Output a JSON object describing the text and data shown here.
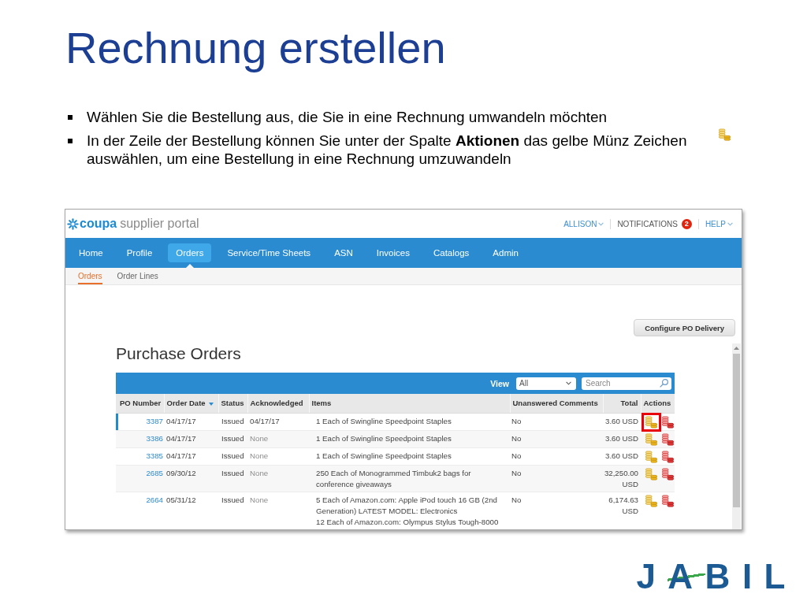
{
  "title": "Rechnung erstellen",
  "bullets": [
    {
      "text": "Wählen Sie die Bestellung aus, die Sie in eine Rechnung umwandeln möchten",
      "coin_icon": false
    },
    {
      "text": "In der Zeile der Bestellung können Sie unter der Spalte **Aktionen** das gelbe Münz Zeichen auswählen, um eine Bestellung in eine Rechnung umzuwandeln",
      "coin_icon": true
    }
  ],
  "portal": {
    "logo": {
      "brand": "coupa",
      "tagline": "supplier portal"
    },
    "top_links": [
      {
        "kind": "menu",
        "label": "ALLISON"
      },
      {
        "kind": "counter",
        "label": "NOTIFICATIONS",
        "badge": "2"
      },
      {
        "kind": "menu",
        "label": "HELP"
      }
    ],
    "nav": [
      {
        "label": "Home",
        "selected": false
      },
      {
        "label": "Profile",
        "selected": false
      },
      {
        "label": "Orders",
        "selected": true
      },
      {
        "label": "Service/Time Sheets",
        "selected": false
      },
      {
        "label": "ASN",
        "selected": false
      },
      {
        "label": "Invoices",
        "selected": false
      },
      {
        "label": "Catalogs",
        "selected": false
      },
      {
        "label": "Admin",
        "selected": false
      }
    ],
    "subnav": [
      {
        "label": "Orders",
        "selected": true
      },
      {
        "label": "Order Lines",
        "selected": false
      }
    ],
    "configure_button": "Configure PO Delivery",
    "heading": "Purchase Orders",
    "toolbar": {
      "view_label": "View",
      "view_value": "All",
      "search": {
        "placeholder": "Search"
      }
    },
    "table": {
      "columns": [
        {
          "label": "PO Number",
          "sorted": false
        },
        {
          "label": "Order Date",
          "sorted": true
        },
        {
          "label": "Status",
          "sorted": false
        },
        {
          "label": "Acknowledged",
          "sorted": false
        },
        {
          "label": "Items",
          "sorted": false
        },
        {
          "label": "Unanswered Comments",
          "sorted": false
        },
        {
          "label": "Total",
          "sorted": false
        },
        {
          "label": "Actions",
          "sorted": false
        }
      ],
      "rows": [
        {
          "po_number": "3387",
          "order_date": "04/17/17",
          "status": "Issued",
          "acknowledged": "04/17/17",
          "acknowledged_dimmed": false,
          "items": [
            "1 Each of Swingline Speedpoint Staples"
          ],
          "unanswered_comments": "No",
          "total": "3.60 USD",
          "selected": true,
          "highlighted": true
        },
        {
          "po_number": "3386",
          "order_date": "04/17/17",
          "status": "Issued",
          "acknowledged": "None",
          "acknowledged_dimmed": true,
          "items": [
            "1 Each of Swingline Speedpoint Staples"
          ],
          "unanswered_comments": "No",
          "total": "3.60 USD",
          "selected": false,
          "highlighted": false
        },
        {
          "po_number": "3385",
          "order_date": "04/17/17",
          "status": "Issued",
          "acknowledged": "None",
          "acknowledged_dimmed": true,
          "items": [
            "1 Each of Swingline Speedpoint Staples"
          ],
          "unanswered_comments": "No",
          "total": "3.60 USD",
          "selected": false,
          "highlighted": false
        },
        {
          "po_number": "2685",
          "order_date": "09/30/12",
          "status": "Issued",
          "acknowledged": "None",
          "acknowledged_dimmed": true,
          "items": [
            "250 Each of Monogrammed Timbuk2 bags for conference giveaways"
          ],
          "unanswered_comments": "No",
          "total": "32,250.00 USD",
          "selected": false,
          "highlighted": false
        },
        {
          "po_number": "2664",
          "order_date": "05/31/12",
          "status": "Issued",
          "acknowledged": "None",
          "acknowledged_dimmed": true,
          "items": [
            "5 Each of Amazon.com: Apple iPod touch 16 GB (2nd Generation) LATEST MODEL: Electronics",
            "12 Each of Amazon.com: Olympus Stylus Tough-8000"
          ],
          "unanswered_comments": "No",
          "total": "6,174.63 USD",
          "selected": false,
          "highlighted": false
        }
      ]
    }
  },
  "company_logo": "JABIL"
}
